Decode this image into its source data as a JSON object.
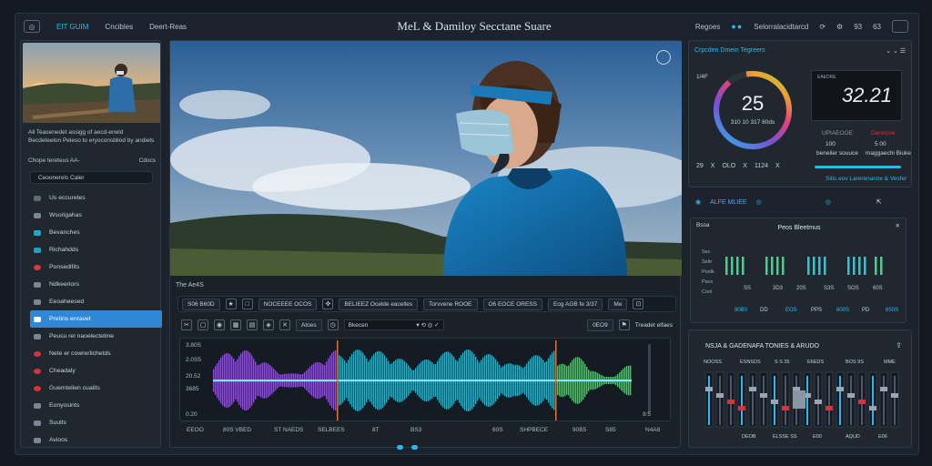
{
  "topbar": {
    "links": [
      "EIT GUIM",
      "Cncibles",
      "Deert-Reas"
    ],
    "title": "MeL & Damiloy Secctane Suare",
    "right_label": "Regoes",
    "right_item": "Selorralacidtarcd",
    "right_num1": "93",
    "right_num2": "63"
  },
  "sidebar": {
    "caption": "All Teasenedet assigg of aecd-eneld Becdeteelon Peleso to eryoconsbliod by andiets",
    "section_label": "Chope tereteus AA-",
    "section_right": "Cdocs",
    "search_value": "Ceoonerels Caler",
    "items": [
      {
        "label": "Us eccuretes",
        "color": "#5f6a75"
      },
      {
        "label": "Wsorigahas",
        "color": "#7a8694"
      },
      {
        "label": "Bevanches",
        "color": "#1ea7c9"
      },
      {
        "label": "Richahdds",
        "color": "#1fa0c2"
      },
      {
        "label": "Ponsedlfits",
        "color": "#d83a3a"
      },
      {
        "label": "Ndkeeriors",
        "color": "#7a8694"
      },
      {
        "label": "Eeoaheesed",
        "color": "#7a8694"
      },
      {
        "label": "Pretins enravet",
        "color": "#ffffff"
      },
      {
        "label": "Peusu rei naoelectetine",
        "color": "#7a8694"
      },
      {
        "label": "Nete er cowrerlichetds",
        "color": "#d8323a"
      },
      {
        "label": "Cheadaly",
        "color": "#d8323a"
      },
      {
        "label": "Guemtellen cualits",
        "color": "#d8323a"
      },
      {
        "label": "Eonyosints",
        "color": "#7a8694"
      },
      {
        "label": "Suults",
        "color": "#7a8694"
      },
      {
        "label": "Avioos",
        "color": "#7a8694"
      }
    ]
  },
  "viewer": {
    "track_label": "The Ae4S",
    "ctrl1": [
      "S06 B60D",
      "NOCEEEE OCOS",
      "BELIEEZ Ocelde eacelles",
      "Torvvene ROOE",
      "O6 EOCE ORESS",
      "Eog AGB fe 3/37",
      "Me"
    ],
    "ctrl2_chip": "Atoes",
    "ctrl2_select": "Bkecen",
    "ctrl2_time": "0EO9",
    "ctrl2_end": "Treadet elfaes",
    "y_labels": [
      "3.80S",
      "2.0S5",
      "20.52",
      "3685",
      "0.20"
    ],
    "y_right": "9:5",
    "timeline": [
      "EEOO",
      "80S VBED",
      "ST NAEDS",
      "SELBEES",
      "8T",
      "BS3",
      "60S",
      "SHPBECE",
      "90B5",
      "S85",
      "N4A8"
    ]
  },
  "right": {
    "card1_title": "Crpcden Dmein Tegreers",
    "ring_value": "25",
    "ring_sub": "310 10 317 80ds",
    "ring_tl": "1/4F",
    "lcd_value": "32.21",
    "lcd_top": "EAEDRE",
    "kv_left_label": "UPIAEOOE",
    "kv_left_v1": "100",
    "kv_left_v2": "beneiler souuce",
    "kv_right_label": "Deretcoe",
    "kv_right_v1": "5 00",
    "kv_right_v2": "maggaechi Biuke",
    "row_values": [
      "29",
      "X",
      "OLO",
      "X",
      "1124",
      "X"
    ],
    "cyan_caption": "Sitis eov Larerenanze & Vesfer",
    "sec2_label": "ALFE MLIEE",
    "card2_title": "Peos Bleetmus",
    "card2_left": "Bssa",
    "card2_rows": [
      "Sec",
      "Seltr",
      "Poelk",
      "Pacs",
      "Cool"
    ],
    "card2_x": [
      "SS",
      "3D3",
      "20S",
      "S3S",
      "SOS",
      "60S"
    ],
    "card2_row3": [
      "80B0",
      "DD",
      "EOS",
      "PPS",
      "600S",
      "PD",
      "650S"
    ],
    "card3_title": "NSJA & GADENAFA TONIES & ARUDO",
    "card3_labels": [
      "NOOSS",
      "ESNSDS",
      "S S 35",
      "E6EDS",
      "BOS 9S",
      "MME"
    ],
    "card3_bottom": [
      "DEOB",
      "ELSSE SS",
      "E00",
      "AQUD",
      "E06"
    ]
  },
  "colors": {
    "accent": "#28b9f0",
    "active": "#2f87d6",
    "alert": "#d8323a"
  }
}
